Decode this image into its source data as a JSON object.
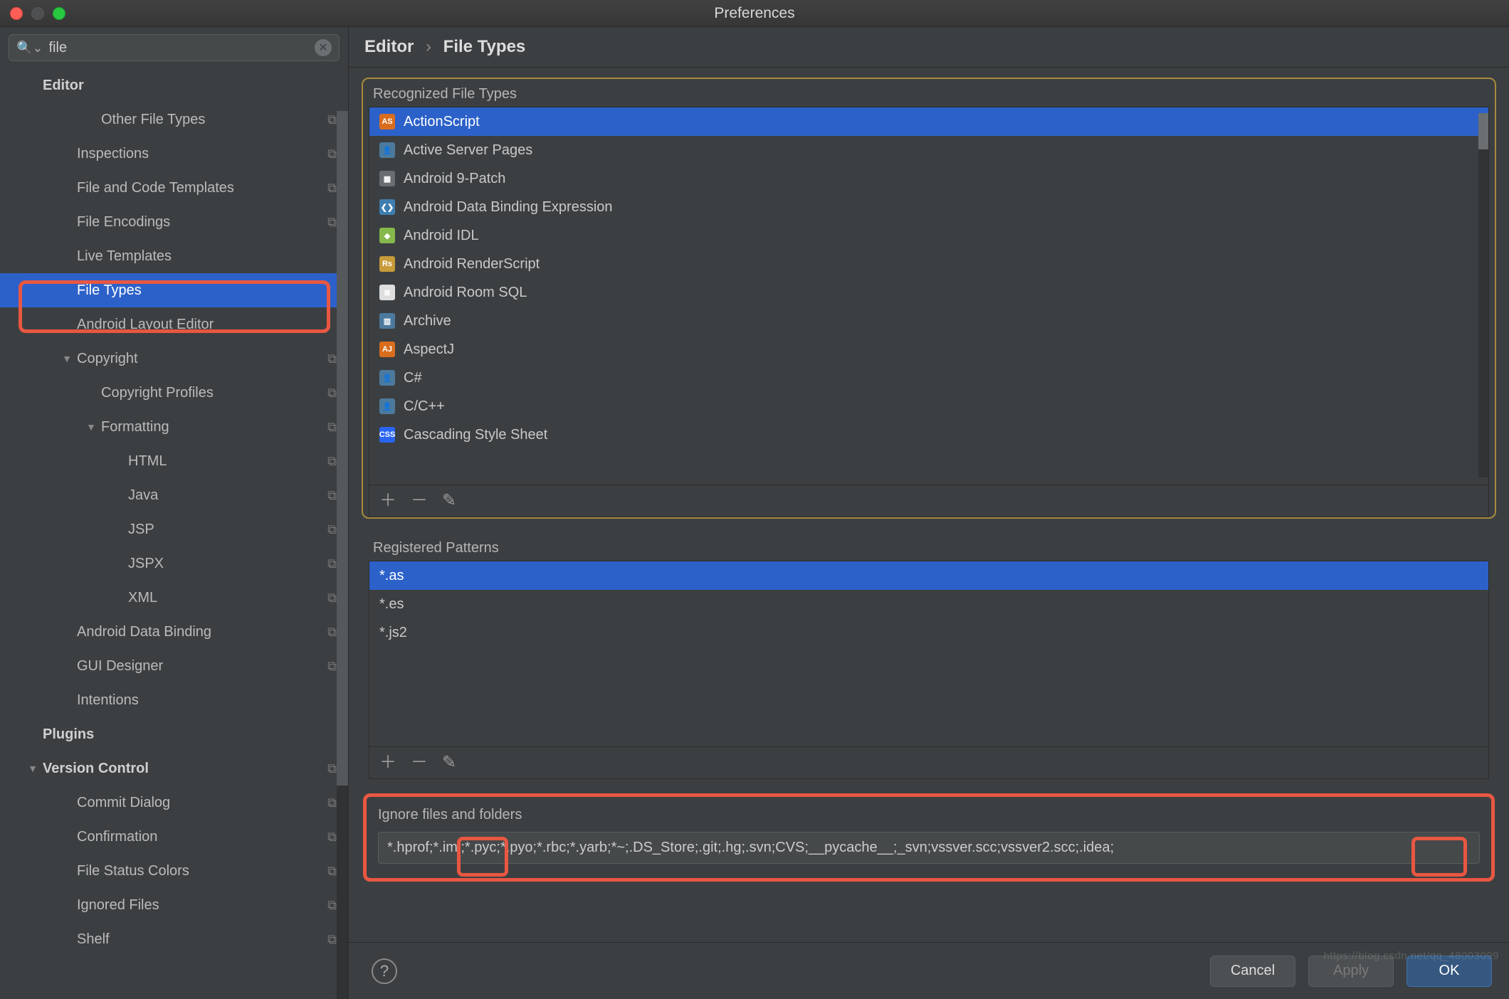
{
  "window": {
    "title": "Preferences"
  },
  "search": {
    "value": "file",
    "placeholder": ""
  },
  "breadcrumb": {
    "root": "Editor",
    "leaf": "File Types"
  },
  "sidebar": [
    {
      "label": "Editor",
      "indent": 0,
      "bold": true,
      "arrow": "",
      "copy": false
    },
    {
      "label": "Other File Types",
      "indent": 2,
      "copy": true
    },
    {
      "label": "Inspections",
      "indent": 1,
      "copy": true
    },
    {
      "label": "File and Code Templates",
      "indent": 1,
      "copy": true
    },
    {
      "label": "File Encodings",
      "indent": 1,
      "copy": true
    },
    {
      "label": "Live Templates",
      "indent": 1,
      "copy": false
    },
    {
      "label": "File Types",
      "indent": 1,
      "copy": false,
      "selected": true
    },
    {
      "label": "Android Layout Editor",
      "indent": 1,
      "copy": false
    },
    {
      "label": "Copyright",
      "indent": 1,
      "copy": true,
      "arrow": "▼"
    },
    {
      "label": "Copyright Profiles",
      "indent": 2,
      "copy": true
    },
    {
      "label": "Formatting",
      "indent": 2,
      "copy": true,
      "arrow": "▼"
    },
    {
      "label": "HTML",
      "indent": 3,
      "copy": true
    },
    {
      "label": "Java",
      "indent": 3,
      "copy": true
    },
    {
      "label": "JSP",
      "indent": 3,
      "copy": true
    },
    {
      "label": "JSPX",
      "indent": 3,
      "copy": true
    },
    {
      "label": "XML",
      "indent": 3,
      "copy": true
    },
    {
      "label": "Android Data Binding",
      "indent": 1,
      "copy": true
    },
    {
      "label": "GUI Designer",
      "indent": 1,
      "copy": true
    },
    {
      "label": "Intentions",
      "indent": 1,
      "copy": false
    },
    {
      "label": "Plugins",
      "indent": 0,
      "bold": true
    },
    {
      "label": "Version Control",
      "indent": 0,
      "bold": true,
      "copy": true,
      "arrow": "▼"
    },
    {
      "label": "Commit Dialog",
      "indent": 1,
      "copy": true
    },
    {
      "label": "Confirmation",
      "indent": 1,
      "copy": true
    },
    {
      "label": "File Status Colors",
      "indent": 1,
      "copy": true
    },
    {
      "label": "Ignored Files",
      "indent": 1,
      "copy": true
    },
    {
      "label": "Shelf",
      "indent": 1,
      "copy": true
    }
  ],
  "recognized": {
    "title": "Recognized File Types",
    "items": [
      {
        "label": "ActionScript",
        "selected": true,
        "icon": "AS",
        "iconbg": "#d96d1e"
      },
      {
        "label": "Active Server Pages",
        "icon": "👤",
        "iconbg": "#4c7a9e"
      },
      {
        "label": "Android 9-Patch",
        "icon": "▦",
        "iconbg": "#6b6e70"
      },
      {
        "label": "Android Data Binding Expression",
        "icon": "❮❯",
        "iconbg": "#3e7eb0"
      },
      {
        "label": "Android IDL",
        "icon": "◆",
        "iconbg": "#86b84c"
      },
      {
        "label": "Android RenderScript",
        "icon": "Rs",
        "iconbg": "#c79a3a"
      },
      {
        "label": "Android Room SQL",
        "icon": "≣",
        "iconbg": "#dedede"
      },
      {
        "label": "Archive",
        "icon": "▥",
        "iconbg": "#4c7a9e"
      },
      {
        "label": "AspectJ",
        "icon": "AJ",
        "iconbg": "#d96d1e"
      },
      {
        "label": "C#",
        "icon": "👤",
        "iconbg": "#4c7a9e"
      },
      {
        "label": "C/C++",
        "icon": "👤",
        "iconbg": "#4c7a9e"
      },
      {
        "label": "Cascading Style Sheet",
        "icon": "CSS",
        "iconbg": "#2965f1"
      }
    ]
  },
  "patterns": {
    "title": "Registered Patterns",
    "items": [
      {
        "label": "*.as",
        "selected": true
      },
      {
        "label": "*.es"
      },
      {
        "label": "*.js2"
      }
    ]
  },
  "ignore": {
    "title": "Ignore files and folders",
    "value": "*.hprof;*.iml;*.pyc;*.pyo;*.rbc;*.yarb;*~;.DS_Store;.git;.hg;.svn;CVS;__pycache__;_svn;vssver.scc;vssver2.scc;.idea;"
  },
  "buttons": {
    "cancel": "Cancel",
    "apply": "Apply",
    "ok": "OK"
  },
  "watermark": "https://blog.csdn.net/qq_48003099"
}
